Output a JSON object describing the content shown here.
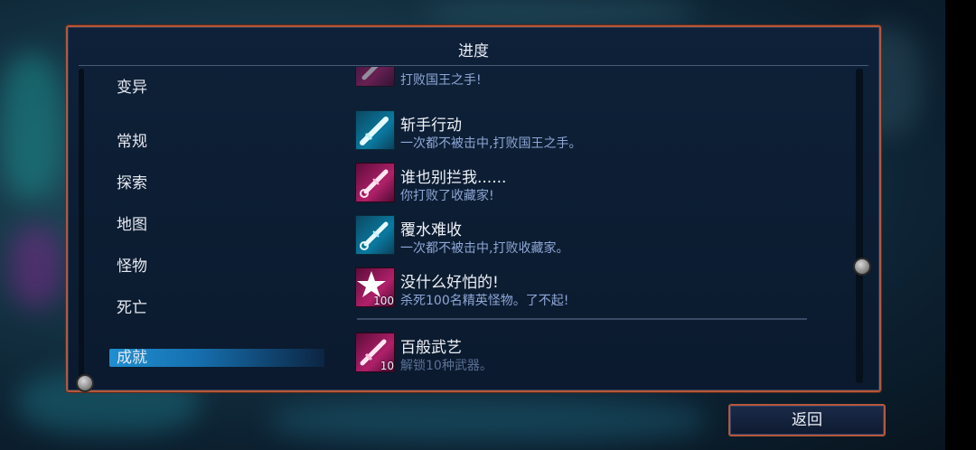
{
  "panel": {
    "title": "进度"
  },
  "sidebar": {
    "items": [
      {
        "label": "变异",
        "selected": false
      },
      {
        "label": "常规",
        "selected": false
      },
      {
        "label": "探索",
        "selected": false
      },
      {
        "label": "地图",
        "selected": false
      },
      {
        "label": "怪物",
        "selected": false
      },
      {
        "label": "死亡",
        "selected": false
      },
      {
        "label": "成就",
        "selected": true
      }
    ]
  },
  "achievements": [
    {
      "name": "",
      "desc": "打败国王之手!",
      "icon": "sword-icon",
      "color": "#b0206a",
      "partial": true
    },
    {
      "name": "斩手行动",
      "desc": "一次都不被击中,打败国王之手。",
      "icon": "sword-icon",
      "color": "#0a7aa0"
    },
    {
      "name": "谁也别拦我......",
      "desc": "你打败了收藏家!",
      "icon": "syringe-icon",
      "color": "#b0206a"
    },
    {
      "name": "覆水难收",
      "desc": "一次都不被击中,打败收藏家。",
      "icon": "syringe-icon",
      "color": "#0a7aa0"
    },
    {
      "name": "没什么好怕的!",
      "desc": "杀死100名精英怪物。了不起!",
      "icon": "star-icon",
      "color": "#b0206a",
      "badge": "100"
    },
    {
      "name": "百般武艺",
      "desc": "解锁10种武器。",
      "icon": "sword-icon",
      "color": "#b0206a",
      "badge": "10",
      "locked": true
    }
  ],
  "footer": {
    "back_label": "返回"
  }
}
